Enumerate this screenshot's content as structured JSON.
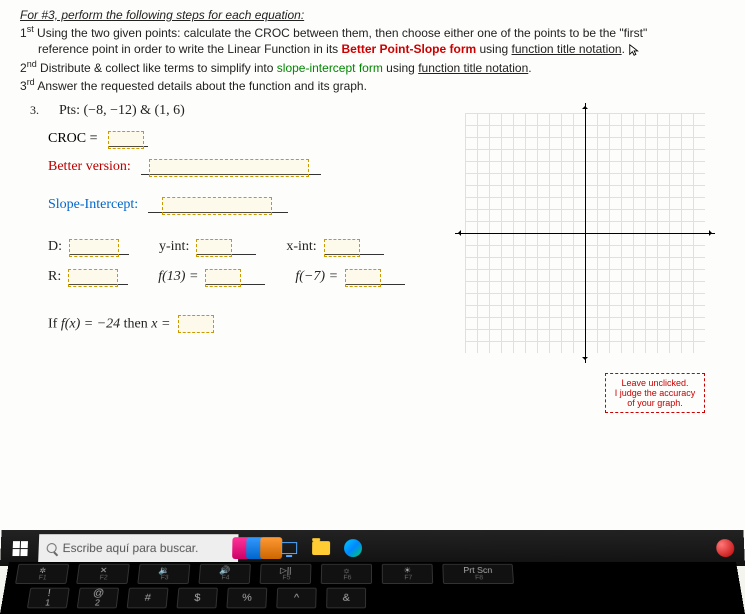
{
  "header": {
    "title": "For #3, perform the following steps for each equation:",
    "step1_a": "1",
    "step1_sup": "st",
    "step1_b": " Using the two given points: calculate the CROC between them, then choose either one of the points to be the \"first\"",
    "step1_c": "reference point in order to write the Linear Function in its ",
    "step1_red": "Better Point-Slope form",
    "step1_d": " using ",
    "step1_u": "function title notation",
    "step1_e": ".",
    "step2_a": "2",
    "step2_sup": "nd",
    "step2_b": " Distribute & collect like terms to simplify into ",
    "step2_green": "slope-intercept form",
    "step2_c": " using ",
    "step2_u": "function title notation",
    "step2_d": ".",
    "step3_a": "3",
    "step3_sup": "rd",
    "step3_b": " Answer the requested details about the function and its graph."
  },
  "q": {
    "num": "3.",
    "pts": "Pts: (−8, −12) & (1, 6)",
    "croc_label": "CROC =",
    "better_label": "Better version:",
    "slope_label": "Slope-Intercept:",
    "D": "D:",
    "yint": "y-int:",
    "xint": "x-int:",
    "R": "R:",
    "f13": "f(13) =",
    "fn7": "f(−7) =",
    "if_a": "If ",
    "if_fx": "f(x) = −24",
    "if_b": " then ",
    "if_x": "x ="
  },
  "leave": {
    "l1": "Leave unclicked.",
    "l2": "I judge the accuracy",
    "l3": "of your graph."
  },
  "taskbar": {
    "search_placeholder": "Escribe aquí para buscar."
  },
  "keys": {
    "f1": "F1",
    "f2": "F2",
    "f3": "F3",
    "f4": "F4",
    "f5": "F5",
    "f6": "F6",
    "f7": "F7",
    "prt": "Prt Scn",
    "prt_sub": "F8",
    "excl": "!",
    "n1": "1",
    "at": "@",
    "n2": "2",
    "hash": "#",
    "dollar": "$",
    "percent": "%",
    "caret": "^",
    "amp": "&",
    "speaker_mute": "✕",
    "speaker_low": "🔉",
    "speaker_hi": "🔊",
    "playpause": "▷||",
    "bright_lo": "☼",
    "bright_hi": "☀"
  }
}
